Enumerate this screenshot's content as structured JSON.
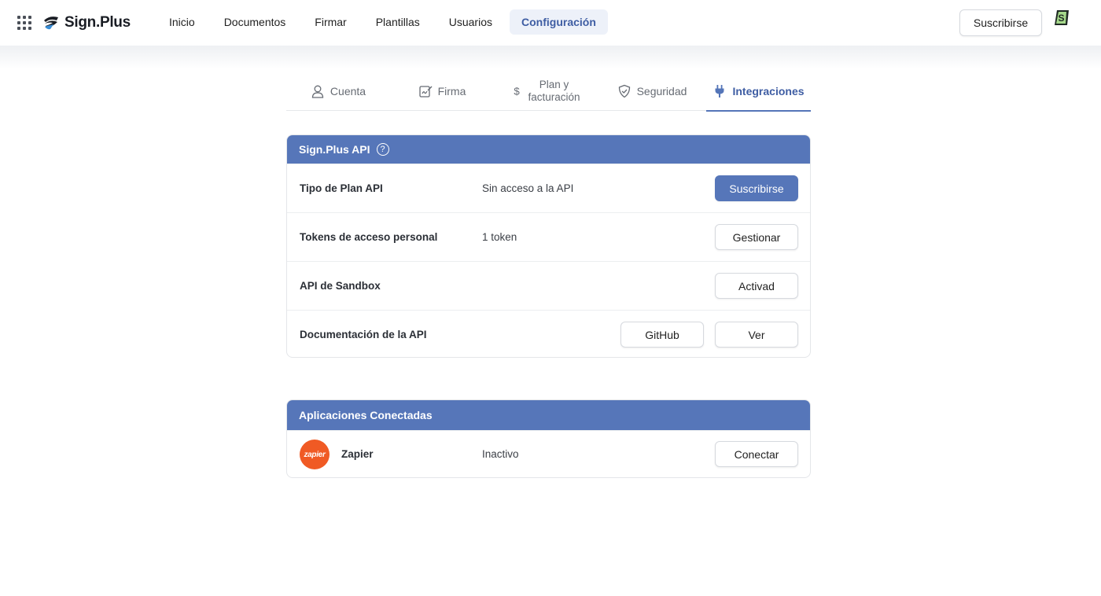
{
  "app": {
    "logo_text": "Sign.Plus"
  },
  "nav": {
    "items": [
      {
        "label": "Inicio"
      },
      {
        "label": "Documentos"
      },
      {
        "label": "Firmar"
      },
      {
        "label": "Plantillas"
      },
      {
        "label": "Usuarios"
      },
      {
        "label": "Configuración"
      }
    ],
    "active": "Configuración",
    "subscribe_label": "Suscribirse"
  },
  "tabs": [
    {
      "label": "Cuenta",
      "icon": "user-icon"
    },
    {
      "label": "Firma",
      "icon": "signature-icon"
    },
    {
      "label": "Plan y facturación",
      "line1": "Plan y",
      "line2": "facturación",
      "icon": "dollar-icon"
    },
    {
      "label": "Seguridad",
      "icon": "shield-icon"
    },
    {
      "label": "Integraciones",
      "icon": "plug-icon",
      "active": true
    }
  ],
  "api_panel": {
    "title": "Sign.Plus API",
    "help": "?",
    "rows": [
      {
        "label": "Tipo de Plan API",
        "value": "Sin acceso a la API",
        "button": "Suscribirse"
      },
      {
        "label": "Tokens de acceso personal",
        "value": "1 token",
        "button": "Gestionar"
      },
      {
        "label": "API de Sandbox",
        "value": "",
        "button": "Activad"
      },
      {
        "label": "Documentación de la API",
        "value": "",
        "button_secondary": "GitHub",
        "button": "Ver"
      }
    ]
  },
  "apps_panel": {
    "title": "Aplicaciones Conectadas",
    "apps": [
      {
        "logo_text": "zapier",
        "name": "Zapier",
        "status": "Inactivo",
        "button": "Conectar"
      }
    ]
  },
  "colors": {
    "accent": "#5676b9",
    "accent_text": "#3e5da3",
    "zapier": "#f05a24"
  }
}
